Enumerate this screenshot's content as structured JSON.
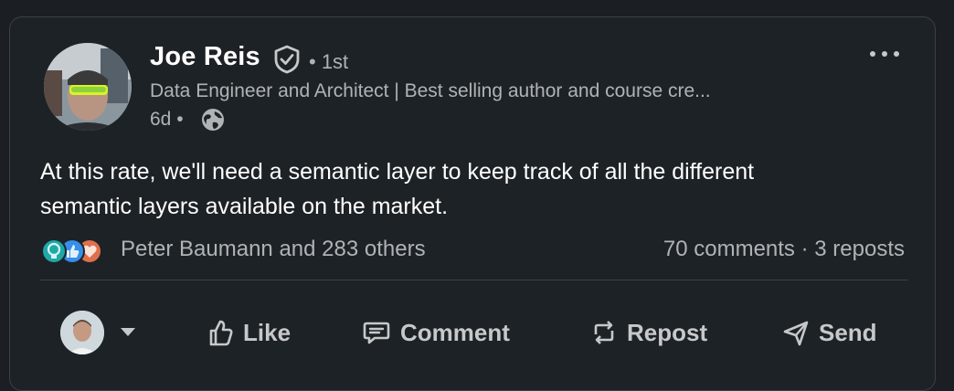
{
  "post": {
    "author": {
      "name": "Joe Reis",
      "degree": "• 1st",
      "headline": "Data Engineer and Architect | Best selling author and course cre...",
      "timestamp": "6d •",
      "verified_icon": "shield-check-icon",
      "visibility_icon": "globe-icon"
    },
    "more_label": "•••",
    "body": [
      "At this rate, we'll need a semantic layer to keep track of all the different",
      "semantic layers available on the market."
    ],
    "reactions": {
      "icons": [
        "insightful-icon",
        "like-icon",
        "love-icon"
      ],
      "names_text": "Peter Baumann and 283 others"
    },
    "counts": {
      "comments": "70 comments",
      "separator": "·",
      "reposts": "3 reposts"
    }
  },
  "actions": {
    "like": "Like",
    "comment": "Comment",
    "repost": "Repost",
    "send": "Send"
  },
  "colors": {
    "background": "#1d2226",
    "text_primary": "#ffffff",
    "text_secondary": "#b0b3b5",
    "insightful": "#1fa8a8",
    "like": "#378fe9",
    "love": "#df704d"
  }
}
